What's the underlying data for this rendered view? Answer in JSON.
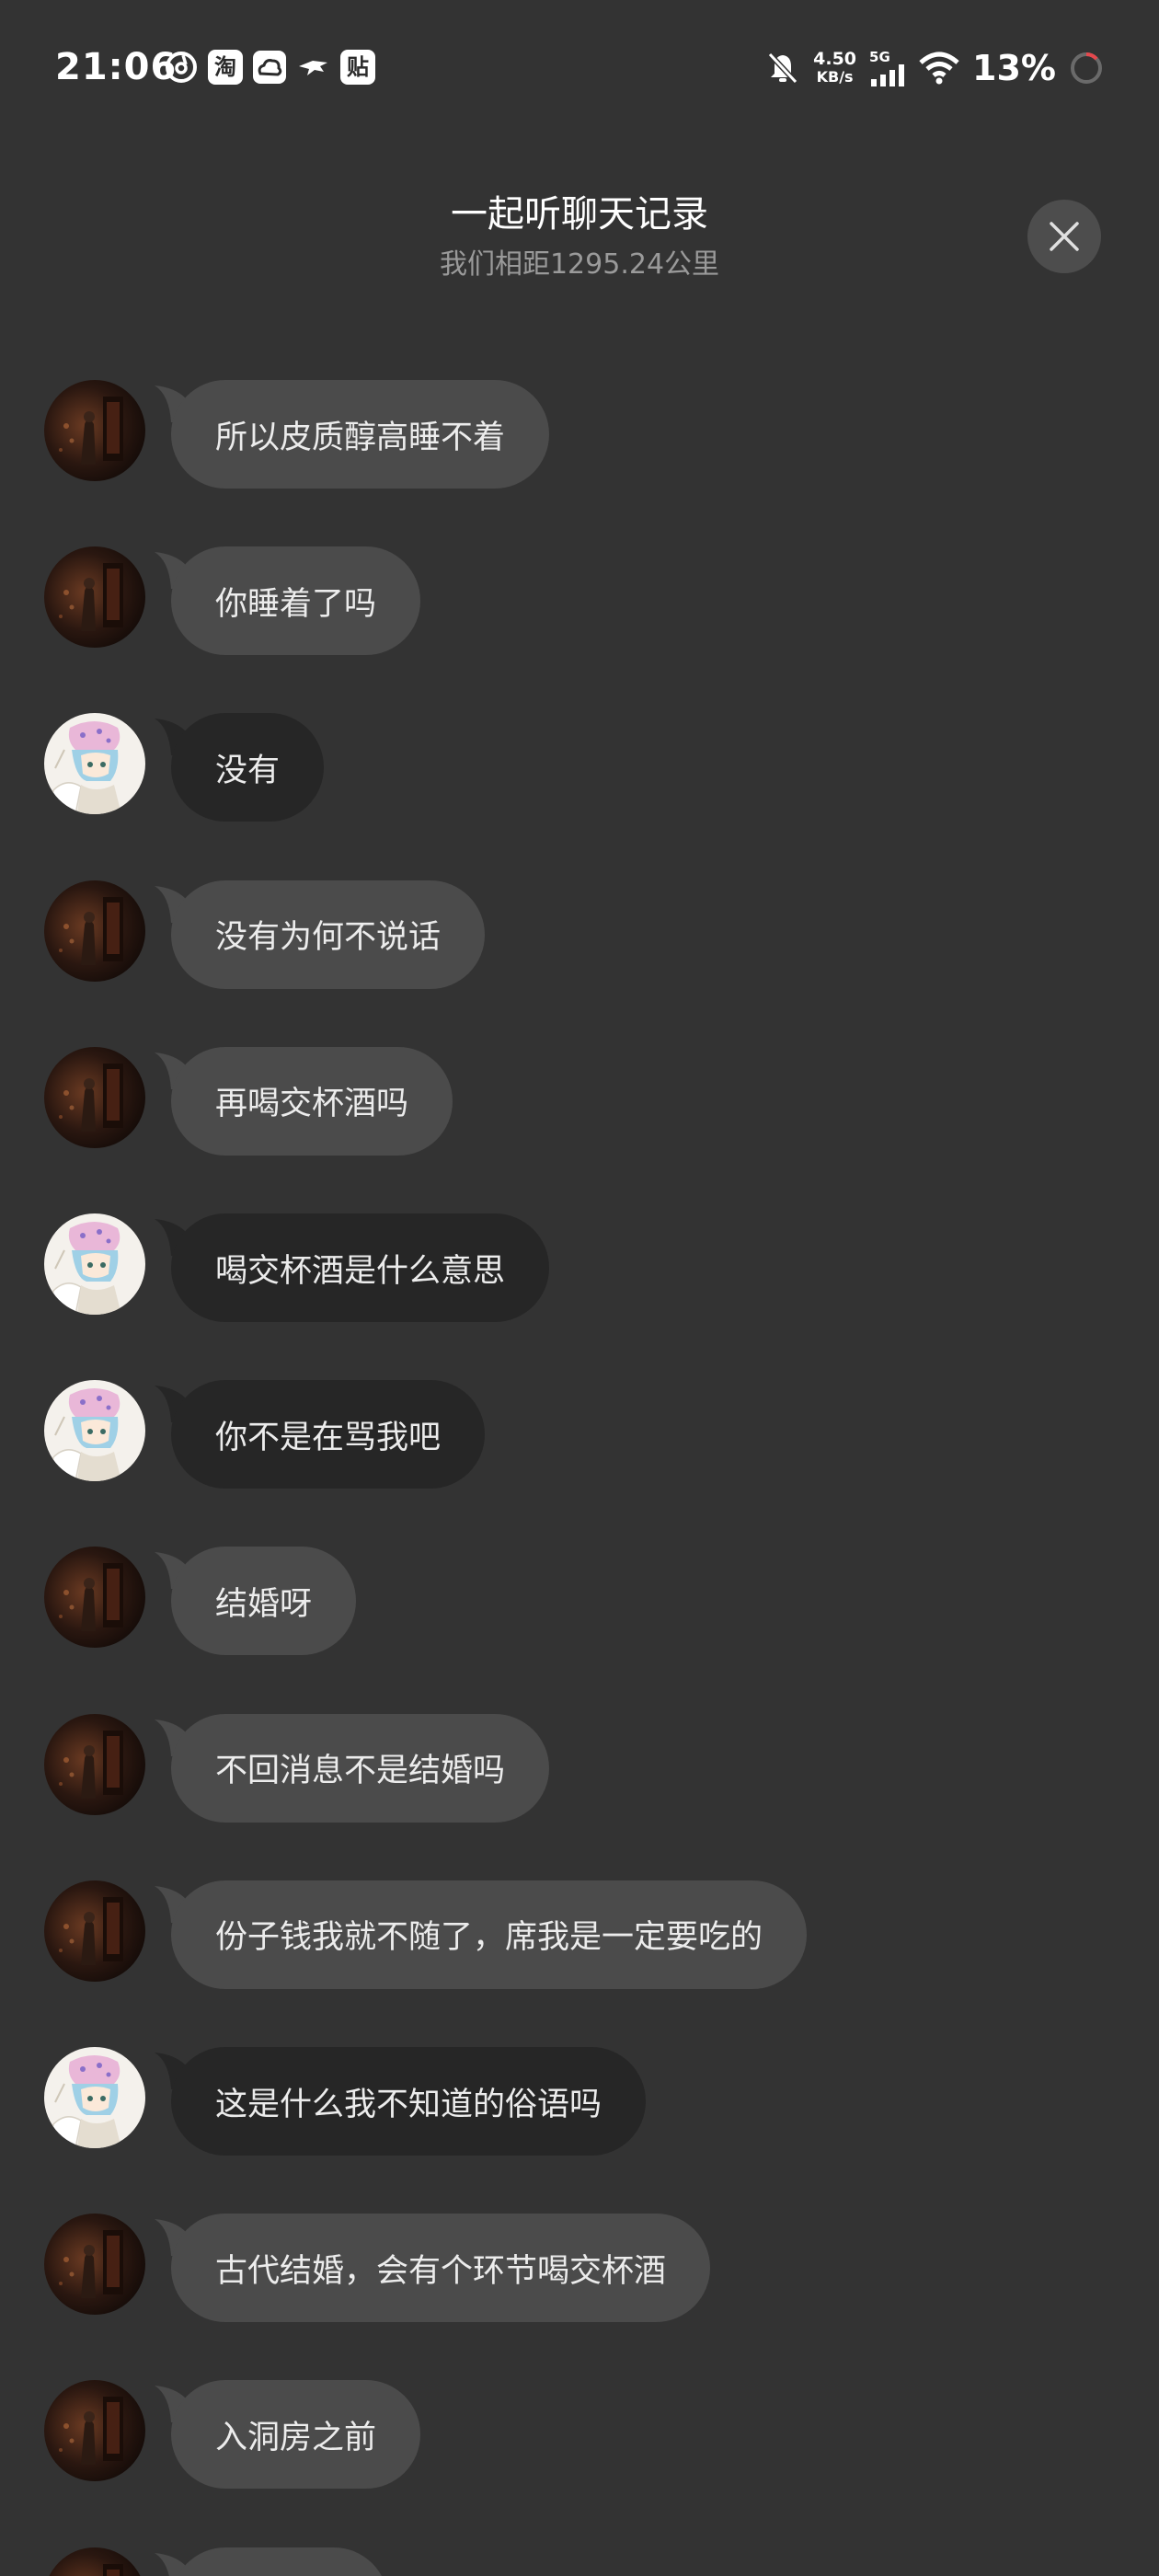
{
  "status_bar": {
    "time": "21:06",
    "app_icons": [
      "netease-music-icon",
      "taobao-icon",
      "cloud-app-icon",
      "bird-app-icon",
      "tieba-icon"
    ],
    "taobao_label": "淘",
    "tieba_label": "贴",
    "net_speed": "4.50",
    "net_speed_unit": "KB/s",
    "network_type": "5G",
    "battery_percent": "13%"
  },
  "header": {
    "title": "一起听聊天记录",
    "subtitle": "我们相距1295.24公里"
  },
  "colors": {
    "background": "#333333",
    "bubble_other": "#4b4b4b",
    "bubble_self": "#262626",
    "subtitle": "#9a9a9a"
  },
  "messages": [
    {
      "sender": "other",
      "text": "所以皮质醇高睡不着"
    },
    {
      "sender": "other",
      "text": "你睡着了吗"
    },
    {
      "sender": "self",
      "text": "没有"
    },
    {
      "sender": "other",
      "text": "没有为何不说话"
    },
    {
      "sender": "other",
      "text": "再喝交杯酒吗"
    },
    {
      "sender": "self",
      "text": "喝交杯酒是什么意思"
    },
    {
      "sender": "self",
      "text": "你不是在骂我吧"
    },
    {
      "sender": "other",
      "text": "结婚呀"
    },
    {
      "sender": "other",
      "text": "不回消息不是结婚吗"
    },
    {
      "sender": "other",
      "text": "份子钱我就不随了，席我是一定要吃的"
    },
    {
      "sender": "self",
      "text": "这是什么我不知道的俗语吗"
    },
    {
      "sender": "other",
      "text": "古代结婚，会有个环节喝交杯酒"
    },
    {
      "sender": "other",
      "text": "入洞房之前"
    },
    {
      "sender": "other",
      "text": ""
    }
  ]
}
